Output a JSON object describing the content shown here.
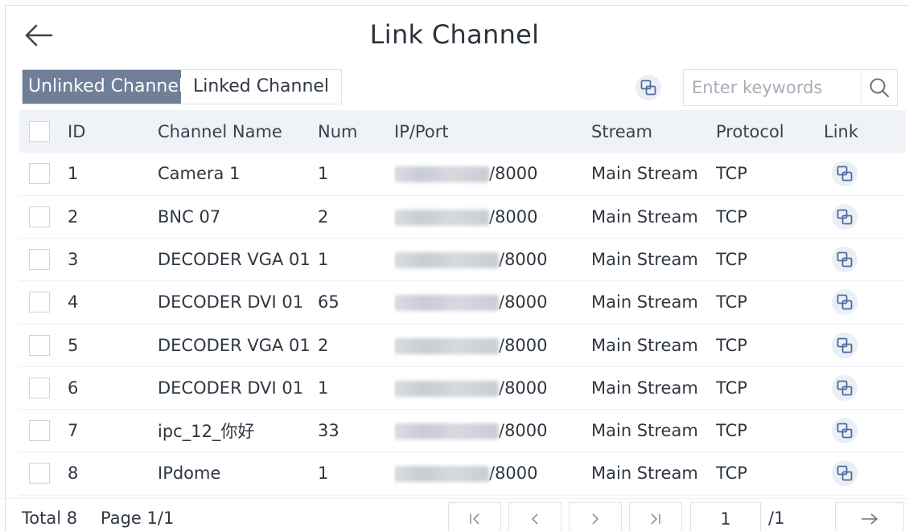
{
  "header": {
    "title": "Link Channel"
  },
  "tabs": [
    {
      "label": "Unlinked Channel",
      "active": true
    },
    {
      "label": "Linked Channel",
      "active": false
    }
  ],
  "search": {
    "placeholder": "Enter keywords",
    "value": ""
  },
  "table": {
    "columns": [
      "ID",
      "Channel Name",
      "Num",
      "IP/Port",
      "Stream",
      "Protocol",
      "Link"
    ],
    "rows": [
      {
        "id": "1",
        "name": "Camera 1",
        "num": "1",
        "port": "/8000",
        "stream": "Main Stream",
        "protocol": "TCP"
      },
      {
        "id": "2",
        "name": "BNC 07",
        "num": "2",
        "port": "/8000",
        "stream": "Main Stream",
        "protocol": "TCP"
      },
      {
        "id": "3",
        "name": "DECODER VGA 01",
        "num": "1",
        "port": "/8000",
        "stream": "Main Stream",
        "protocol": "TCP"
      },
      {
        "id": "4",
        "name": "DECODER DVI 01",
        "num": "65",
        "port": "/8000",
        "stream": "Main Stream",
        "protocol": "TCP"
      },
      {
        "id": "5",
        "name": "DECODER VGA 01",
        "num": "2",
        "port": "/8000",
        "stream": "Main Stream",
        "protocol": "TCP"
      },
      {
        "id": "6",
        "name": "DECODER DVI 01",
        "num": "1",
        "port": "/8000",
        "stream": "Main Stream",
        "protocol": "TCP"
      },
      {
        "id": "7",
        "name": "ipc_12_你好",
        "num": "33",
        "port": "/8000",
        "stream": "Main Stream",
        "protocol": "TCP"
      },
      {
        "id": "8",
        "name": "IPdome",
        "num": "1",
        "port": "/8000",
        "stream": "Main Stream",
        "protocol": "TCP"
      }
    ]
  },
  "footer": {
    "total": "Total 8",
    "page": "Page 1/1",
    "page_input": "1",
    "page_total": "/1"
  },
  "icons": {
    "back": "arrow-left-icon",
    "batch_link": "link-icon",
    "search": "search-icon",
    "row_link": "link-icon",
    "first": "first-page-icon",
    "prev": "chevron-left-icon",
    "next": "chevron-right-icon",
    "last": "last-page-icon",
    "go": "arrow-right-icon"
  },
  "colors": {
    "active_tab": "#6f7f98",
    "header_row": "#eff2f6",
    "link_bubble": "#eaeff6",
    "link_icon": "#4f6c9a"
  }
}
